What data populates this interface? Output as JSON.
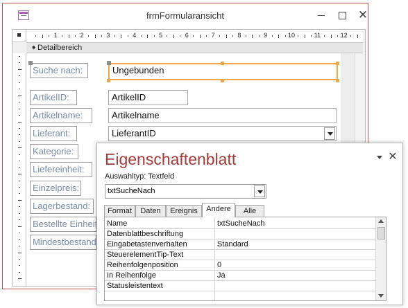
{
  "window": {
    "title": "frmFormularansicht",
    "close_glyph": "✕"
  },
  "design": {
    "section_label": "Detailbereich",
    "ruler_numbers": [
      "1",
      "2",
      "3",
      "4",
      "5",
      "6",
      "7",
      "8",
      "9",
      "10",
      "11",
      "12"
    ],
    "labels": [
      "Suche nach:",
      "ArtikelID:",
      "Artikelname:",
      "Lieferant:",
      "Kategorie:",
      "Liefereinheit:",
      "Einzelpreis:",
      "Lagerbestand:",
      "Bestellte Einheiten:",
      "Mindestbestand:"
    ],
    "fields": {
      "search": "Ungebunden",
      "artikelid": "ArtikelID",
      "artikelname": "Artikelname",
      "lieferant": "LieferantID"
    },
    "selection_color": "#f0a84a"
  },
  "property_sheet": {
    "title": "Eigenschaftenblatt",
    "close_glyph": "✕",
    "selection_type": "Auswahltyp:  Textfeld",
    "object": "txtSucheNach",
    "tabs": [
      "Format",
      "Daten",
      "Ereignis",
      "Andere",
      "Alle"
    ],
    "active_tab": "Andere",
    "title_color": "#a33b3a",
    "rows": [
      {
        "name": "Name",
        "value": "txtSucheNach"
      },
      {
        "name": "Datenblattbeschriftung",
        "value": ""
      },
      {
        "name": "Eingabetastenverhalten",
        "value": "Standard"
      },
      {
        "name": "SteuerelementTip-Text",
        "value": ""
      },
      {
        "name": "Reihenfolgenposition",
        "value": "0"
      },
      {
        "name": "In Reihenfolge",
        "value": "Ja"
      },
      {
        "name": "Statusleistentext",
        "value": ""
      }
    ]
  }
}
